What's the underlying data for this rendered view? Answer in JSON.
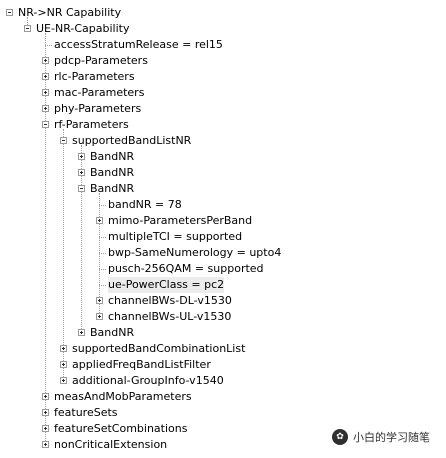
{
  "tree": {
    "nodes": [
      {
        "label": "NR->NR Capability",
        "depth": 0,
        "expander": "minus"
      },
      {
        "label": "UE-NR-Capability",
        "depth": 1,
        "expander": "minus"
      },
      {
        "label": "accessStratumRelease = rel15",
        "depth": 2,
        "expander": "none"
      },
      {
        "label": "pdcp-Parameters",
        "depth": 2,
        "expander": "plus"
      },
      {
        "label": "rlc-Parameters",
        "depth": 2,
        "expander": "plus"
      },
      {
        "label": "mac-Parameters",
        "depth": 2,
        "expander": "plus"
      },
      {
        "label": "phy-Parameters",
        "depth": 2,
        "expander": "plus"
      },
      {
        "label": "rf-Parameters",
        "depth": 2,
        "expander": "minus"
      },
      {
        "label": "supportedBandListNR",
        "depth": 3,
        "expander": "minus"
      },
      {
        "label": "BandNR",
        "depth": 4,
        "expander": "plus"
      },
      {
        "label": "BandNR",
        "depth": 4,
        "expander": "plus"
      },
      {
        "label": "BandNR",
        "depth": 4,
        "expander": "minus"
      },
      {
        "label": "bandNR = 78",
        "depth": 5,
        "expander": "none"
      },
      {
        "label": "mimo-ParametersPerBand",
        "depth": 5,
        "expander": "plus"
      },
      {
        "label": "multipleTCI = supported",
        "depth": 5,
        "expander": "none"
      },
      {
        "label": "bwp-SameNumerology = upto4",
        "depth": 5,
        "expander": "none"
      },
      {
        "label": "pusch-256QAM = supported",
        "depth": 5,
        "expander": "none"
      },
      {
        "label": "ue-PowerClass = pc2",
        "depth": 5,
        "expander": "none",
        "selected": true
      },
      {
        "label": "channelBWs-DL-v1530",
        "depth": 5,
        "expander": "plus"
      },
      {
        "label": "channelBWs-UL-v1530",
        "depth": 5,
        "expander": "plus"
      },
      {
        "label": "BandNR",
        "depth": 4,
        "expander": "plus"
      },
      {
        "label": "supportedBandCombinationList",
        "depth": 3,
        "expander": "plus"
      },
      {
        "label": "appliedFreqBandListFilter",
        "depth": 3,
        "expander": "plus"
      },
      {
        "label": "additional-GroupInfo-v1540",
        "depth": 3,
        "expander": "plus"
      },
      {
        "label": "measAndMobParameters",
        "depth": 2,
        "expander": "plus"
      },
      {
        "label": "featureSets",
        "depth": 2,
        "expander": "plus"
      },
      {
        "label": "featureSetCombinations",
        "depth": 2,
        "expander": "plus"
      },
      {
        "label": "nonCriticalExtension",
        "depth": 2,
        "expander": "plus"
      }
    ]
  },
  "watermark": {
    "icon": "wechat-icon",
    "text": "小白的学习随笔"
  }
}
